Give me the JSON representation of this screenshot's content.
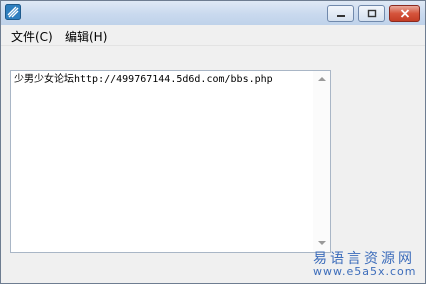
{
  "window": {
    "icon": "app-logo-icon",
    "controls": {
      "minimize": "minimize-icon",
      "maximize": "maximize-icon",
      "close": "close-icon"
    }
  },
  "menu": {
    "items": [
      "文件(C)",
      "编辑(H)"
    ]
  },
  "editor": {
    "text": "少男少女论坛http://499767144.5d6d.com/bbs.php"
  },
  "watermark": {
    "line1": "易语言资源网",
    "line2": "www.e5a5x.com"
  },
  "colors": {
    "watermark": "#3d6dbb",
    "close_button": "#d5543c",
    "titlebar": "#c9d9ee"
  }
}
